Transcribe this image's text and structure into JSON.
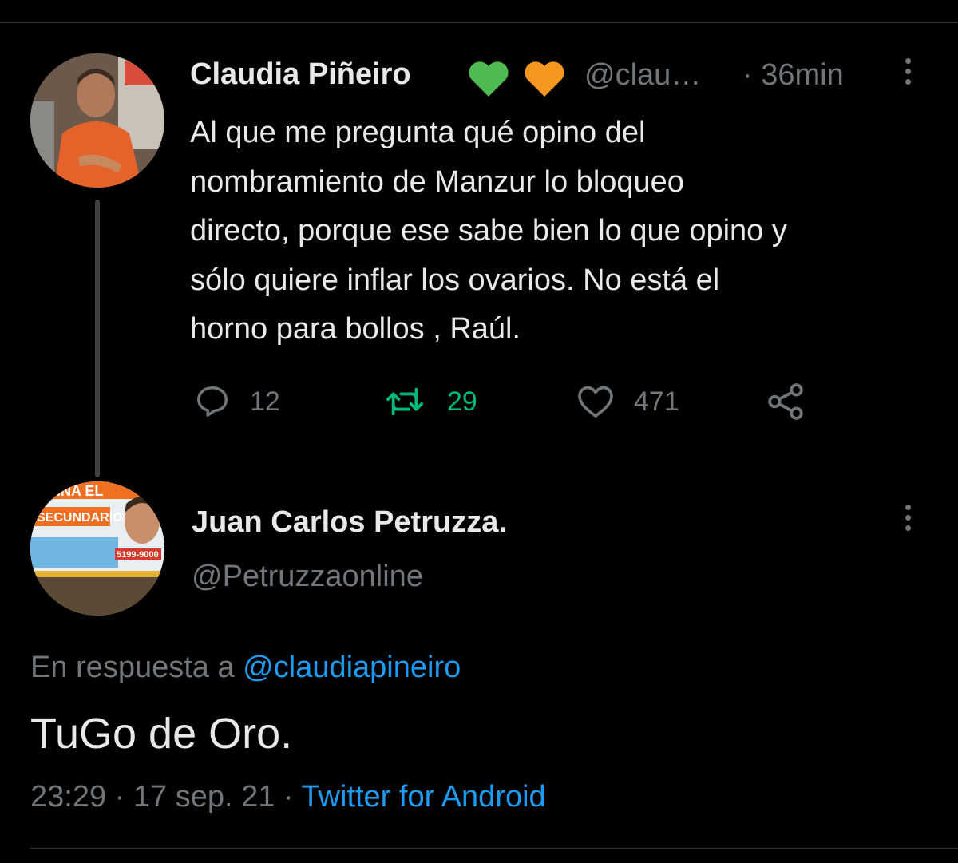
{
  "tweet1": {
    "author_name": "Claudia Piñeiro",
    "handle": "@clau…",
    "time": "· 36min",
    "text_lines": [
      "Al que me pregunta qué opino del",
      "nombramiento de Manzur lo bloqueo",
      "directo, porque ese sabe bien lo que opino y",
      "sólo quiere inflar los ovarios.  No está el",
      "horno para bollos , Raúl."
    ],
    "reply_count": "12",
    "retweet_count": "29",
    "like_count": "471",
    "heart_colors": [
      "#4fba52",
      "#f5961e"
    ]
  },
  "tweet2": {
    "author_name": "Juan Carlos Petruzza.",
    "handle": "@Petruzzaonline",
    "reply_to_prefix": "En respuesta a",
    "reply_to_handle": "@claudiapineiro",
    "text": "TuGo de Oro.",
    "timestamp": "23:29 · 17 sep. 21 ·",
    "source": "Twitter for Android",
    "avatar_sign_lines": [
      "MINA EL",
      "SECUNDARIO",
      "5199-9000"
    ]
  },
  "colors": {
    "background": "#000000",
    "text": "#e7e9ea",
    "muted": "#71767b",
    "link": "#1d9bf0",
    "retweet": "#00ba7c"
  }
}
